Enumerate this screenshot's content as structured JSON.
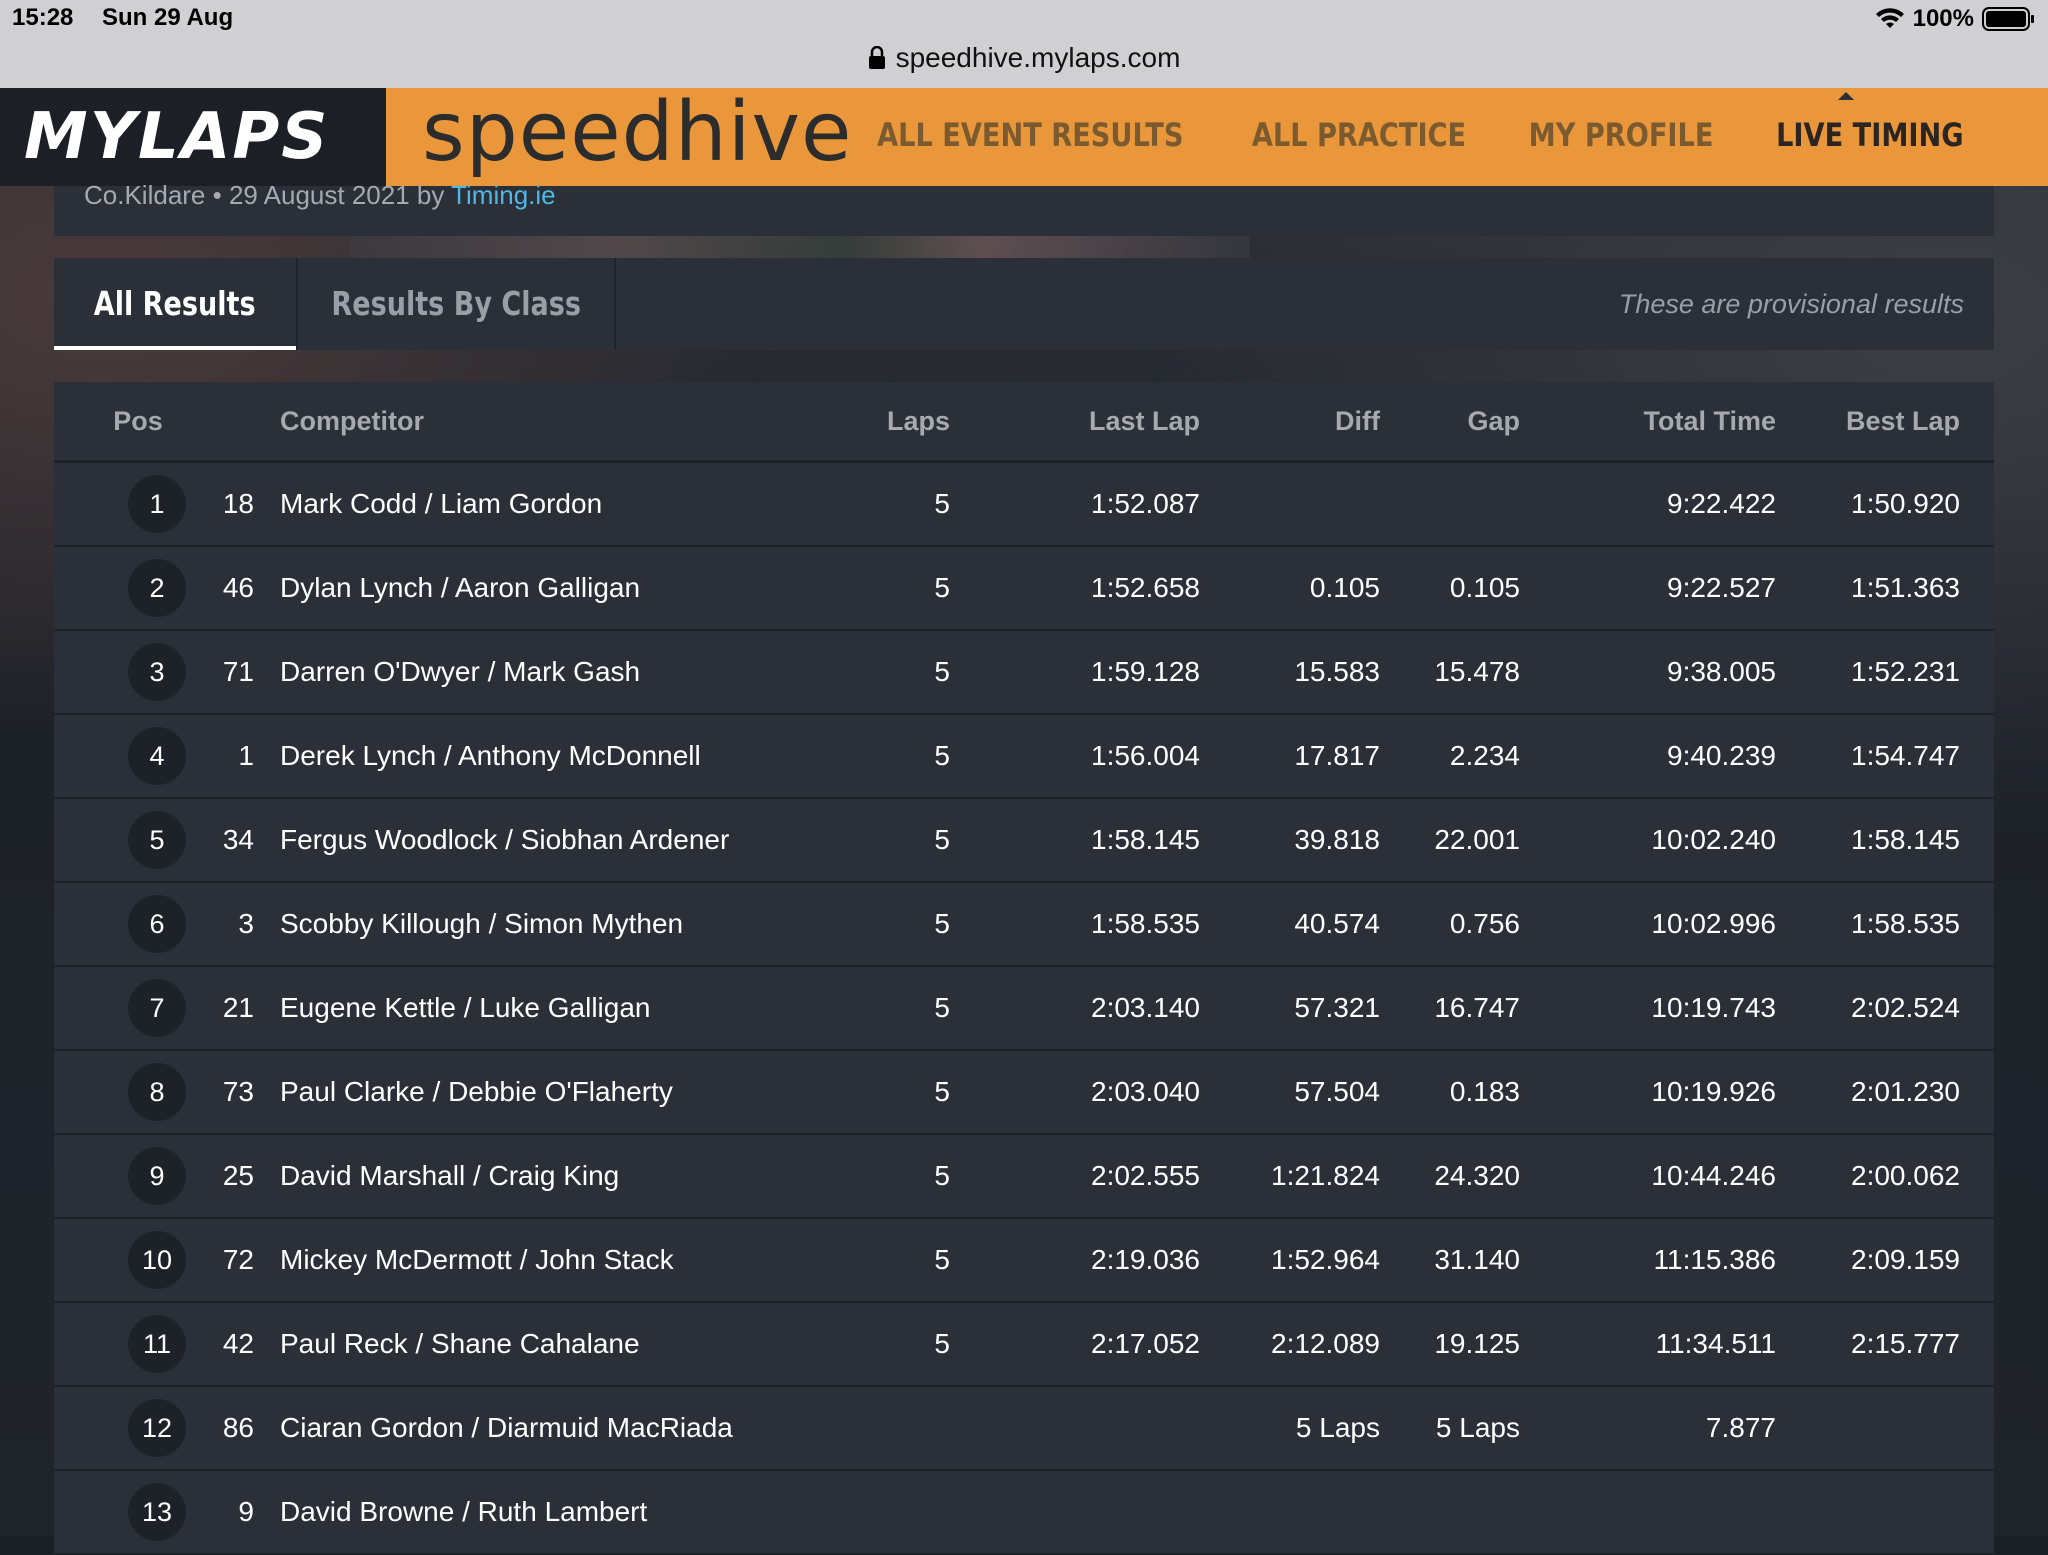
{
  "status_bar": {
    "time": "15:28",
    "date": "Sun 29 Aug",
    "battery": "100%"
  },
  "browser": {
    "url": "speedhive.mylaps.com"
  },
  "header": {
    "logo": "MYLAPS",
    "brand": "speedhive",
    "nav": [
      "ALL EVENT RESULTS",
      "ALL PRACTICE",
      "MY PROFILE",
      "LIVE TIMING"
    ],
    "active_nav": "LIVE TIMING",
    "accent_color": "#e9973a"
  },
  "event": {
    "location_date": "Co.Kildare • 29 August 2021 by",
    "organizer": "Timing.ie"
  },
  "tabs": {
    "all": "All Results",
    "by_class": "Results By Class",
    "note": "These are provisional results"
  },
  "table": {
    "headers": {
      "pos": "Pos",
      "competitor": "Competitor",
      "laps": "Laps",
      "last_lap": "Last Lap",
      "diff": "Diff",
      "gap": "Gap",
      "total_time": "Total Time",
      "best_lap": "Best Lap"
    },
    "rows": [
      {
        "pos": "1",
        "num": "18",
        "competitor": "Mark Codd / Liam Gordon",
        "laps": "5",
        "last_lap": "1:52.087",
        "diff": "",
        "gap": "",
        "total": "9:22.422",
        "best": "1:50.920"
      },
      {
        "pos": "2",
        "num": "46",
        "competitor": "Dylan Lynch / Aaron Galligan",
        "laps": "5",
        "last_lap": "1:52.658",
        "diff": "0.105",
        "gap": "0.105",
        "total": "9:22.527",
        "best": "1:51.363"
      },
      {
        "pos": "3",
        "num": "71",
        "competitor": "Darren O'Dwyer / Mark Gash",
        "laps": "5",
        "last_lap": "1:59.128",
        "diff": "15.583",
        "gap": "15.478",
        "total": "9:38.005",
        "best": "1:52.231"
      },
      {
        "pos": "4",
        "num": "1",
        "competitor": "Derek Lynch / Anthony McDonnell",
        "laps": "5",
        "last_lap": "1:56.004",
        "diff": "17.817",
        "gap": "2.234",
        "total": "9:40.239",
        "best": "1:54.747"
      },
      {
        "pos": "5",
        "num": "34",
        "competitor": "Fergus Woodlock / Siobhan Ardener",
        "laps": "5",
        "last_lap": "1:58.145",
        "diff": "39.818",
        "gap": "22.001",
        "total": "10:02.240",
        "best": "1:58.145"
      },
      {
        "pos": "6",
        "num": "3",
        "competitor": "Scobby Killough / Simon Mythen",
        "laps": "5",
        "last_lap": "1:58.535",
        "diff": "40.574",
        "gap": "0.756",
        "total": "10:02.996",
        "best": "1:58.535"
      },
      {
        "pos": "7",
        "num": "21",
        "competitor": "Eugene Kettle / Luke Galligan",
        "laps": "5",
        "last_lap": "2:03.140",
        "diff": "57.321",
        "gap": "16.747",
        "total": "10:19.743",
        "best": "2:02.524"
      },
      {
        "pos": "8",
        "num": "73",
        "competitor": "Paul Clarke / Debbie O'Flaherty",
        "laps": "5",
        "last_lap": "2:03.040",
        "diff": "57.504",
        "gap": "0.183",
        "total": "10:19.926",
        "best": "2:01.230"
      },
      {
        "pos": "9",
        "num": "25",
        "competitor": "David Marshall / Craig King",
        "laps": "5",
        "last_lap": "2:02.555",
        "diff": "1:21.824",
        "gap": "24.320",
        "total": "10:44.246",
        "best": "2:00.062"
      },
      {
        "pos": "10",
        "num": "72",
        "competitor": "Mickey McDermott / John Stack",
        "laps": "5",
        "last_lap": "2:19.036",
        "diff": "1:52.964",
        "gap": "31.140",
        "total": "11:15.386",
        "best": "2:09.159"
      },
      {
        "pos": "11",
        "num": "42",
        "competitor": "Paul Reck / Shane Cahalane",
        "laps": "5",
        "last_lap": "2:17.052",
        "diff": "2:12.089",
        "gap": "19.125",
        "total": "11:34.511",
        "best": "2:15.777"
      },
      {
        "pos": "12",
        "num": "86",
        "competitor": "Ciaran Gordon / Diarmuid MacRiada",
        "laps": "",
        "last_lap": "",
        "diff": "5 Laps",
        "gap": "5 Laps",
        "total": "7.877",
        "best": ""
      },
      {
        "pos": "13",
        "num": "9",
        "competitor": "David Browne / Ruth Lambert",
        "laps": "",
        "last_lap": "",
        "diff": "",
        "gap": "",
        "total": "",
        "best": ""
      }
    ]
  }
}
